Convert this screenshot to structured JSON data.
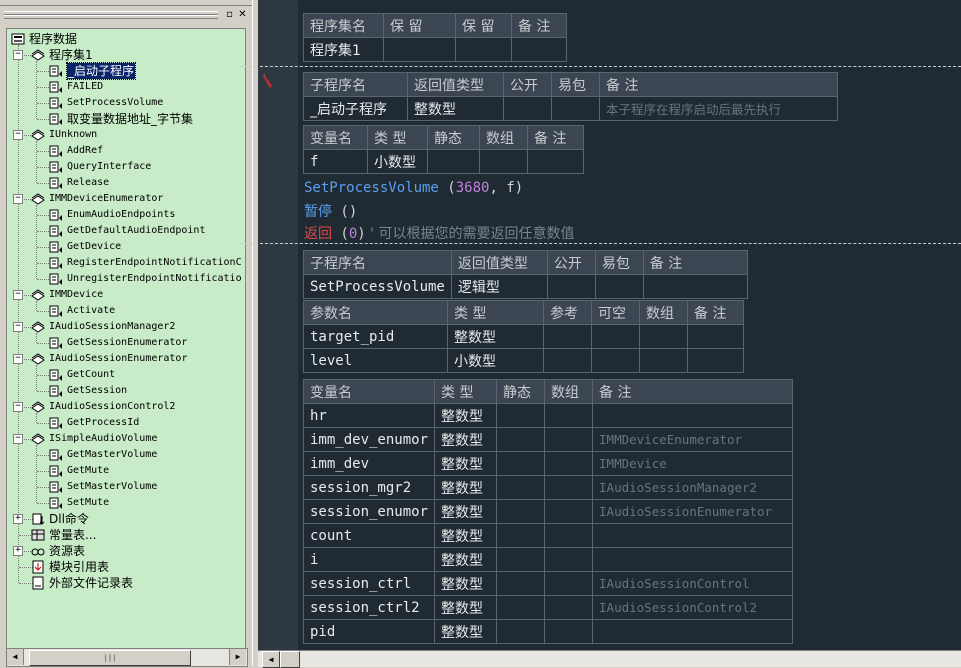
{
  "tree": {
    "root": "程序数据",
    "items": [
      {
        "label": "程序集1",
        "kind": "group"
      },
      {
        "label": "_启动子程序",
        "kind": "sub",
        "selected": true
      },
      {
        "label": "FAILED",
        "kind": "sub"
      },
      {
        "label": "SetProcessVolume",
        "kind": "sub"
      },
      {
        "label": "取变量数据地址_字节集",
        "kind": "sub"
      },
      {
        "label": "IUnknown",
        "kind": "group"
      },
      {
        "label": "AddRef",
        "kind": "sub"
      },
      {
        "label": "QueryInterface",
        "kind": "sub"
      },
      {
        "label": "Release",
        "kind": "sub"
      },
      {
        "label": "IMMDeviceEnumerator",
        "kind": "group"
      },
      {
        "label": "EnumAudioEndpoints",
        "kind": "sub"
      },
      {
        "label": "GetDefaultAudioEndpoint",
        "kind": "sub"
      },
      {
        "label": "GetDevice",
        "kind": "sub"
      },
      {
        "label": "RegisterEndpointNotificationC",
        "kind": "sub"
      },
      {
        "label": "UnregisterEndpointNotificatio",
        "kind": "sub"
      },
      {
        "label": "IMMDevice",
        "kind": "group"
      },
      {
        "label": "Activate",
        "kind": "sub"
      },
      {
        "label": "IAudioSessionManager2",
        "kind": "group"
      },
      {
        "label": "GetSessionEnumerator",
        "kind": "sub"
      },
      {
        "label": "IAudioSessionEnumerator",
        "kind": "group"
      },
      {
        "label": "GetCount",
        "kind": "sub"
      },
      {
        "label": "GetSession",
        "kind": "sub"
      },
      {
        "label": "IAudioSessionControl2",
        "kind": "group"
      },
      {
        "label": "GetProcessId",
        "kind": "sub"
      },
      {
        "label": "ISimpleAudioVolume",
        "kind": "group"
      },
      {
        "label": "GetMasterVolume",
        "kind": "sub"
      },
      {
        "label": "GetMute",
        "kind": "sub"
      },
      {
        "label": "SetMasterVolume",
        "kind": "sub"
      },
      {
        "label": "SetMute",
        "kind": "sub"
      },
      {
        "label": "Dll命令",
        "kind": "dll"
      },
      {
        "label": "常量表...",
        "kind": "const"
      },
      {
        "label": "资源表",
        "kind": "res"
      },
      {
        "label": "模块引用表",
        "kind": "mod"
      },
      {
        "label": "外部文件记录表",
        "kind": "file"
      }
    ]
  },
  "assembly": {
    "headers": [
      "程序集名",
      "保 留",
      "保 留",
      "备 注"
    ],
    "values": [
      "程序集1",
      "",
      "",
      ""
    ]
  },
  "sub1": {
    "headers": [
      "子程序名",
      "返回值类型",
      "公开",
      "易包",
      "备 注"
    ],
    "values": [
      "_启动子程序",
      "整数型",
      "",
      "",
      "本子程序在程序启动后最先执行"
    ],
    "var_headers": [
      "变量名",
      "类 型",
      "静态",
      "数组",
      "备 注"
    ],
    "vars": [
      [
        "f",
        "小数型",
        "",
        "",
        ""
      ]
    ],
    "code": {
      "line1_call": "SetProcessVolume",
      "line1_open": " (",
      "line1_num": "3680",
      "line1_rest": ", f)",
      "line2_kw": "暂停",
      "line2_rest": " ()",
      "line3_kw": "返回",
      "line3_open": " (",
      "line3_num": "0",
      "line3_close": ")",
      "line3_comment": "  ' 可以根据您的需要返回任意数值"
    }
  },
  "sub2": {
    "headers": [
      "子程序名",
      "返回值类型",
      "公开",
      "易包",
      "备 注"
    ],
    "values": [
      "SetProcessVolume",
      "逻辑型",
      "",
      "",
      ""
    ],
    "param_headers": [
      "参数名",
      "类 型",
      "参考",
      "可空",
      "数组",
      "备 注"
    ],
    "params": [
      [
        "target_pid",
        "整数型",
        "",
        "",
        "",
        ""
      ],
      [
        "level",
        "小数型",
        "",
        "",
        "",
        ""
      ]
    ],
    "var_headers": [
      "变量名",
      "类 型",
      "静态",
      "数组",
      "备 注"
    ],
    "vars": [
      [
        "hr",
        "整数型",
        "",
        "",
        ""
      ],
      [
        "imm_dev_enumor",
        "整数型",
        "",
        "",
        "IMMDeviceEnumerator"
      ],
      [
        "imm_dev",
        "整数型",
        "",
        "",
        "IMMDevice"
      ],
      [
        "session_mgr2",
        "整数型",
        "",
        "",
        "IAudioSessionManager2"
      ],
      [
        "session_enumor",
        "整数型",
        "",
        "",
        "IAudioSessionEnumerator"
      ],
      [
        "count",
        "整数型",
        "",
        "",
        ""
      ],
      [
        "i",
        "整数型",
        "",
        "",
        ""
      ],
      [
        "session_ctrl",
        "整数型",
        "",
        "",
        "IAudioSessionControl"
      ],
      [
        "session_ctrl2",
        "整数型",
        "",
        "",
        "IAudioSessionControl2"
      ],
      [
        "pid",
        "整数型",
        "",
        "",
        ""
      ]
    ]
  },
  "scroll_glyph": "|||"
}
